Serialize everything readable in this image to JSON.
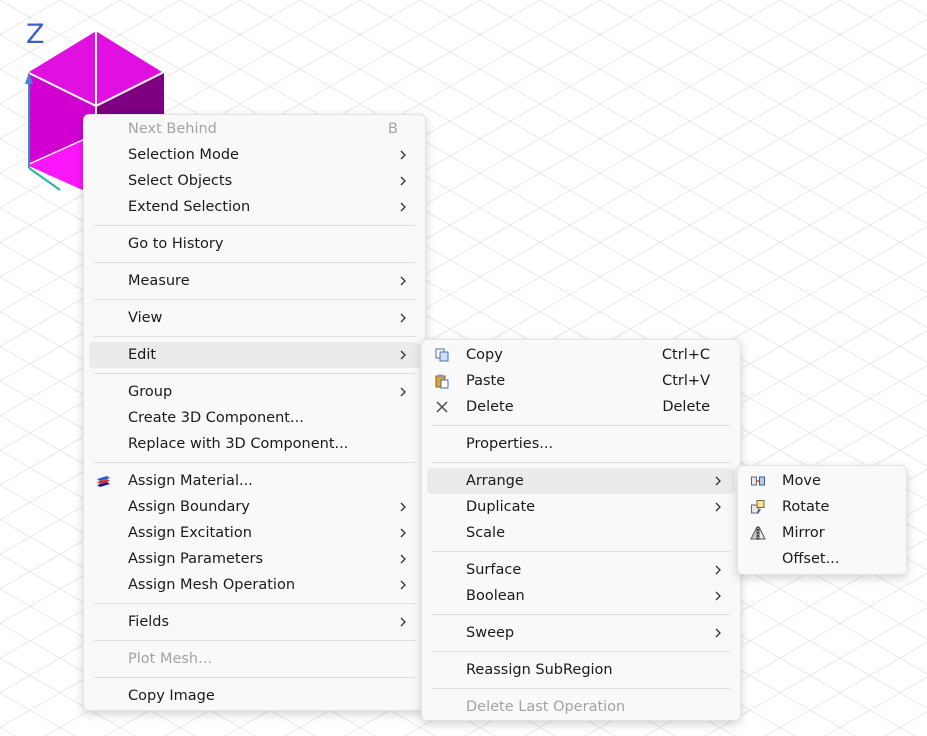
{
  "axis_label": "Z",
  "main_menu": {
    "next_behind": {
      "label": "Next Behind",
      "shortcut": "B"
    },
    "selection_mode": "Selection Mode",
    "select_objects": "Select Objects",
    "extend_selection": "Extend Selection",
    "go_to_history": "Go to History",
    "measure": "Measure",
    "view": "View",
    "edit": "Edit",
    "group": "Group",
    "create_3d_component": "Create 3D Component...",
    "replace_with_3d_component": "Replace with 3D Component...",
    "assign_material": "Assign Material...",
    "assign_boundary": "Assign Boundary",
    "assign_excitation": "Assign Excitation",
    "assign_parameters": "Assign Parameters",
    "assign_mesh_operation": "Assign Mesh Operation",
    "fields": "Fields",
    "plot_mesh": "Plot Mesh...",
    "copy_image": "Copy Image"
  },
  "edit_menu": {
    "copy": {
      "label": "Copy",
      "shortcut": "Ctrl+C"
    },
    "paste": {
      "label": "Paste",
      "shortcut": "Ctrl+V"
    },
    "delete": {
      "label": "Delete",
      "shortcut": "Delete"
    },
    "properties": "Properties...",
    "arrange": "Arrange",
    "duplicate": "Duplicate",
    "scale": "Scale",
    "surface": "Surface",
    "boolean": "Boolean",
    "sweep": "Sweep",
    "reassign_subregion": "Reassign SubRegion",
    "delete_last_operation": "Delete Last Operation"
  },
  "arrange_menu": {
    "move": "Move",
    "rotate": "Rotate",
    "mirror": "Mirror",
    "offset": "Offset..."
  },
  "icons": {
    "copy": "copy-icon",
    "paste": "paste-icon",
    "delete": "delete-x-icon",
    "assign_material": "material-icon",
    "move": "move-icon",
    "rotate": "rotate-icon",
    "mirror": "mirror-icon",
    "submenu": "chevron-right-icon"
  },
  "colors": {
    "cube_front": "#d100d1",
    "cube_top": "#e010e0",
    "cube_side": "#7c0080",
    "cube_bottom": "#ff1aff",
    "axis_label": "#3a5fcd",
    "highlight": "#ebebeb",
    "disabled_text": "#a3a3a3"
  }
}
